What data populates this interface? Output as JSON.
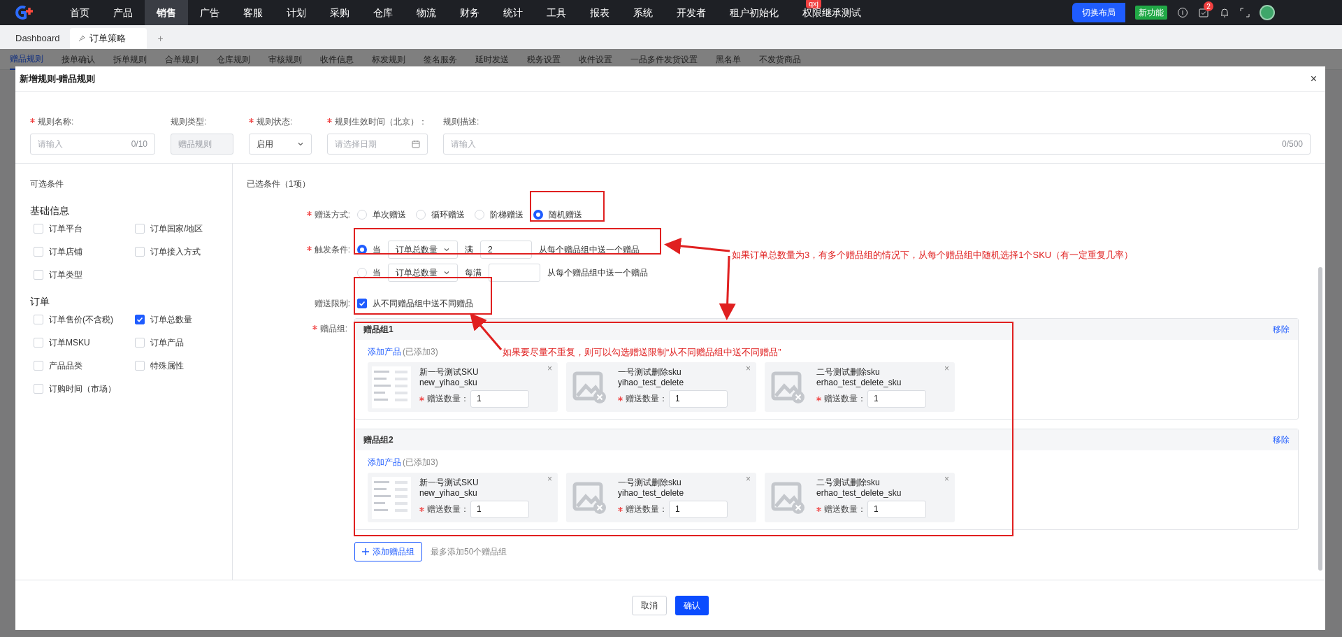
{
  "top_nav": {
    "items": [
      {
        "label": "首页",
        "selected": false
      },
      {
        "label": "产品",
        "selected": false
      },
      {
        "label": "销售",
        "selected": true
      },
      {
        "label": "广告",
        "selected": false
      },
      {
        "label": "客服",
        "selected": false
      },
      {
        "label": "计划",
        "selected": false
      },
      {
        "label": "采购",
        "selected": false
      },
      {
        "label": "仓库",
        "selected": false
      },
      {
        "label": "物流",
        "selected": false
      },
      {
        "label": "财务",
        "selected": false
      },
      {
        "label": "统计",
        "selected": false
      },
      {
        "label": "工具",
        "selected": false
      },
      {
        "label": "报表",
        "selected": false
      },
      {
        "label": "系统",
        "selected": false
      },
      {
        "label": "开发者",
        "selected": false
      },
      {
        "label": "租户初始化",
        "selected": false
      },
      {
        "label": "权限继承测试",
        "selected": false,
        "badge": "qxj"
      }
    ],
    "layout_button": "切换布局",
    "new_feature": "新功能",
    "notification_count": "2"
  },
  "tabs": [
    {
      "label": "Dashboard",
      "selected": false
    },
    {
      "label": "订单策略",
      "selected": true
    }
  ],
  "add_tab": "+",
  "subtabs": [
    {
      "label": "赠品规则",
      "selected": true
    },
    {
      "label": "接单确认",
      "selected": false
    },
    {
      "label": "拆单规则",
      "selected": false
    },
    {
      "label": "合单规则",
      "selected": false
    },
    {
      "label": "仓库规则",
      "selected": false
    },
    {
      "label": "审核规则",
      "selected": false
    },
    {
      "label": "收件信息",
      "selected": false
    },
    {
      "label": "标发规则",
      "selected": false
    },
    {
      "label": "签名服务",
      "selected": false
    },
    {
      "label": "延时发送",
      "selected": false
    },
    {
      "label": "税务设置",
      "selected": false
    },
    {
      "label": "收件设置",
      "selected": false
    },
    {
      "label": "一品多件发货设置",
      "selected": false
    },
    {
      "label": "黑名单",
      "selected": false
    },
    {
      "label": "不发货商品",
      "selected": false
    }
  ],
  "dialog": {
    "title": "新增规则-赠品规则",
    "close": "×",
    "fields": [
      {
        "kind": "text",
        "label": "规则名称:",
        "required": true,
        "placeholder": "请输入",
        "counter": "0/10"
      },
      {
        "kind": "readonly",
        "label": "规则类型:",
        "required": false,
        "value": "赠品规则"
      },
      {
        "kind": "select",
        "label": "规则状态:",
        "required": true,
        "value": "启用"
      },
      {
        "kind": "date",
        "label": "规则生效时间（北京）：",
        "required": true,
        "placeholder": "请选择日期"
      },
      {
        "kind": "text",
        "label": "规则描述:",
        "required": false,
        "placeholder": "请输入",
        "counter": "0/500"
      }
    ],
    "available": {
      "title": "可选条件",
      "sections": [
        {
          "title": "基础信息",
          "items": [
            {
              "label": "订单平台",
              "checked": false
            },
            {
              "label": "订单国家/地区",
              "checked": false
            },
            {
              "label": "订单店铺",
              "checked": false
            },
            {
              "label": "订单接入方式",
              "checked": false
            },
            {
              "label": "订单类型",
              "checked": false
            }
          ]
        },
        {
          "title": "订单",
          "items": [
            {
              "label": "订单售价(不含税)",
              "checked": false
            },
            {
              "label": "订单总数量",
              "checked": true
            },
            {
              "label": "订单MSKU",
              "checked": false
            },
            {
              "label": "订单产品",
              "checked": false
            },
            {
              "label": "产品品类",
              "checked": false
            },
            {
              "label": "特殊属性",
              "checked": false
            },
            {
              "label": "订购时间（市场）",
              "checked": false
            }
          ]
        }
      ]
    },
    "chosen": {
      "title": "已选条件（1项）",
      "method": {
        "label": "赠送方式:",
        "required": true,
        "options": [
          {
            "label": "单次赠送",
            "selected": false
          },
          {
            "label": "循环赠送",
            "selected": false
          },
          {
            "label": "阶梯赠送",
            "selected": false
          },
          {
            "label": "随机赠送",
            "selected": true
          }
        ]
      },
      "trigger": {
        "label": "触发条件:",
        "required": true,
        "rows": [
          {
            "selected": true,
            "prefix": "当",
            "metric": "订单总数量",
            "op": "满",
            "value": "2",
            "suffix": "从每个赠品组中送一个赠品"
          },
          {
            "selected": false,
            "prefix": "当",
            "metric": "订单总数量",
            "op": "每满",
            "suffix": "从每个赠品组中送一个赠品"
          }
        ]
      },
      "limit": {
        "label": "赠送限制:",
        "checked": true,
        "text": "从不同赠品组中送不同赠品"
      },
      "groups": {
        "label": "赠品组:",
        "required": true,
        "items": [
          {
            "title": "赠品组1",
            "remove": "移除",
            "add_product": "添加产品",
            "added": "(已添加3)",
            "products": [
              {
                "name": "新一号测试SKU",
                "code": "new_yihao_sku",
                "has_image": true,
                "qty_label": "赠送数量：",
                "qty": "1",
                "remove": "×"
              },
              {
                "name": "一号测试删除sku",
                "code": "yihao_test_delete",
                "has_image": false,
                "qty_label": "赠送数量：",
                "qty": "1",
                "remove": "×"
              },
              {
                "name": "二号测试删除sku",
                "code": "erhao_test_delete_sku",
                "has_image": false,
                "qty_label": "赠送数量：",
                "qty": "1",
                "remove": "×"
              }
            ]
          },
          {
            "title": "赠品组2",
            "remove": "移除",
            "add_product": "添加产品",
            "added": "(已添加3)",
            "products": [
              {
                "name": "新一号测试SKU",
                "code": "new_yihao_sku",
                "has_image": true,
                "qty_label": "赠送数量：",
                "qty": "1",
                "remove": "×"
              },
              {
                "name": "一号测试删除sku",
                "code": "yihao_test_delete",
                "has_image": false,
                "qty_label": "赠送数量：",
                "qty": "1",
                "remove": "×"
              },
              {
                "name": "二号测试删除sku",
                "code": "erhao_test_delete_sku",
                "has_image": false,
                "qty_label": "赠送数量：",
                "qty": "1",
                "remove": "×"
              }
            ]
          }
        ],
        "add_group": "添加赠品组",
        "add_group_hint": "最多添加50个赠品组"
      }
    },
    "footer": {
      "cancel": "取消",
      "confirm": "确认"
    }
  },
  "annotations": [
    {
      "text": "如果订单总数量为3，有多个赠品组的情况下，从每个赠品组中随机选择1个SKU（有一定重复几率）"
    },
    {
      "text": "如果要尽量不重复，则可以勾选赠送限制“从不同赠品组中送不同赠品”"
    }
  ]
}
